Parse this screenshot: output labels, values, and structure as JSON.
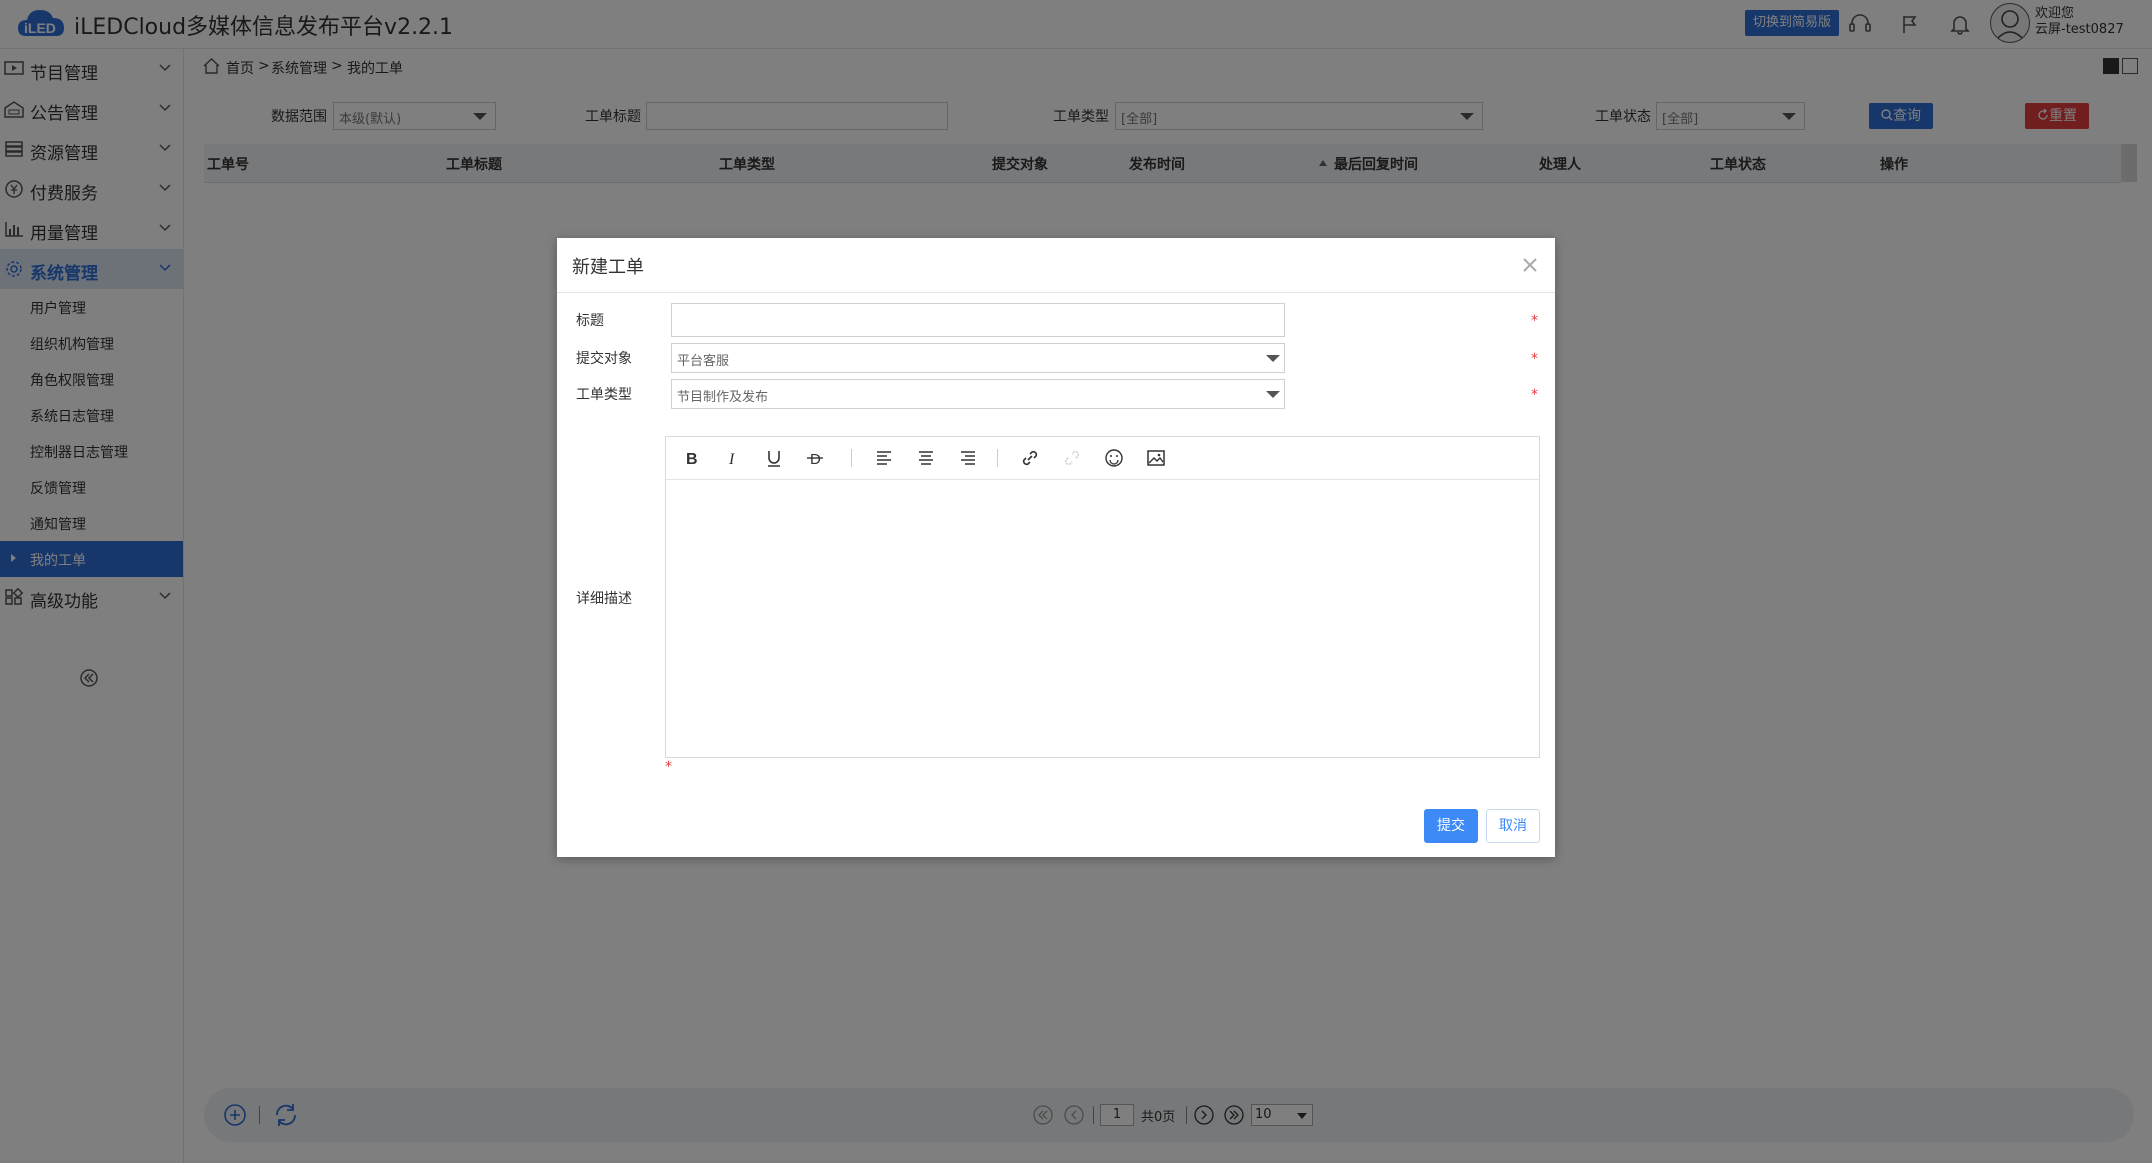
{
  "app": {
    "title": "iLEDCloud多媒体信息发布平台v2.2.1",
    "logo_text": "iLED",
    "switch_button": "切换到简易版",
    "welcome": "欢迎您",
    "user": "云屏-test0827"
  },
  "colors": {
    "primary": "#2f6fd6",
    "danger": "#e03c3c",
    "submit": "#3d8af7",
    "overlay": "rgba(0,0,0,0.5)"
  },
  "sidebar": {
    "items": [
      {
        "label": "节目管理",
        "icon": "program-icon"
      },
      {
        "label": "公告管理",
        "icon": "notice-icon"
      },
      {
        "label": "资源管理",
        "icon": "resource-icon"
      },
      {
        "label": "付费服务",
        "icon": "payment-icon"
      },
      {
        "label": "用量管理",
        "icon": "usage-chart-icon"
      },
      {
        "label": "系统管理",
        "icon": "gear-icon",
        "active": true
      },
      {
        "label": "高级功能",
        "icon": "advanced-icon"
      }
    ],
    "sub_items": [
      {
        "label": "用户管理"
      },
      {
        "label": "组织机构管理"
      },
      {
        "label": "角色权限管理"
      },
      {
        "label": "系统日志管理"
      },
      {
        "label": "控制器日志管理"
      },
      {
        "label": "反馈管理"
      },
      {
        "label": "通知管理"
      },
      {
        "label": "我的工单",
        "active": true
      }
    ]
  },
  "breadcrumb": {
    "home": "首页",
    "sep": ">",
    "section": "系统管理",
    "page": "我的工单"
  },
  "filters": {
    "scope_label": "数据范围",
    "scope_value": "本级(默认)",
    "title_label": "工单标题",
    "title_value": "",
    "type_label": "工单类型",
    "type_value": "[全部]",
    "status_label": "工单状态",
    "status_value": "[全部]",
    "query_button": "查询",
    "reset_button": "重置"
  },
  "table": {
    "columns": [
      "工单号",
      "工单标题",
      "工单类型",
      "提交对象",
      "发布时间",
      "最后回复时间",
      "处理人",
      "工单状态",
      "操作"
    ],
    "rows": []
  },
  "pager": {
    "current_page": "1",
    "total_text": "共0页",
    "page_size": "10"
  },
  "modal": {
    "title": "新建工单",
    "fields": {
      "title_label": "标题",
      "title_value": "",
      "target_label": "提交对象",
      "target_value": "平台客服",
      "type_label": "工单类型",
      "type_value": "节目制作及发布",
      "desc_label": "详细描述",
      "desc_value": ""
    },
    "required_mark": "*",
    "submit_button": "提交",
    "cancel_button": "取消",
    "toolbar": [
      "bold-icon",
      "italic-icon",
      "underline-icon",
      "strikethrough-icon",
      "align-left-icon",
      "align-center-icon",
      "align-right-icon",
      "link-icon",
      "unlink-icon",
      "emoji-icon",
      "image-icon"
    ]
  }
}
